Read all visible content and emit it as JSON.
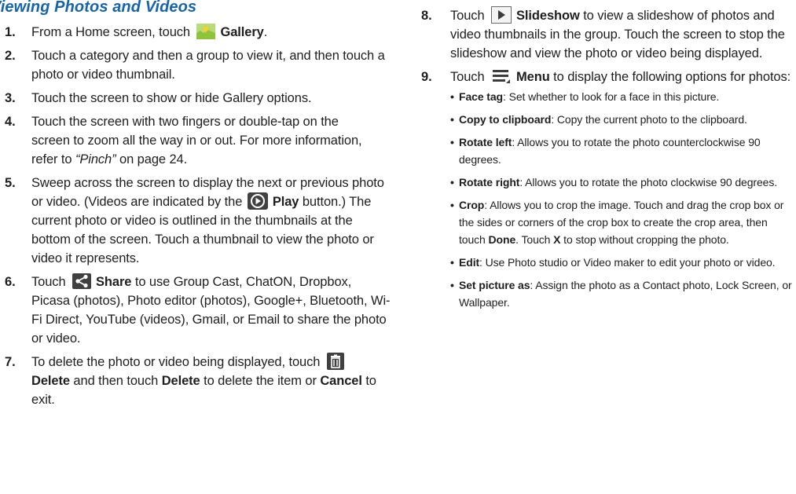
{
  "heading": "Viewing Photos and Videos",
  "left_steps": [
    {
      "num": "1.",
      "a": "From a Home screen, touch",
      "icon": "gallery-icon",
      "bold": "Gallery",
      "b": "."
    },
    {
      "num": "2.",
      "text": "Touch a category and then a group to view it, and then touch a photo or video thumbnail."
    },
    {
      "num": "3.",
      "text": "Touch the screen to show or hide Gallery options."
    },
    {
      "num": "4.",
      "a": "Touch the screen with two fingers or double-tap on the screen to zoom all the way in or out. For more information, refer to ",
      "ref": "“Pinch”",
      "b": " on page 24."
    },
    {
      "num": "5.",
      "a": "Sweep across the screen to display the next or previous photo or video. (Videos are indicated by the",
      "icon": "play-icon",
      "bold": "Play",
      "b": " button.) The current photo or video is outlined in the thumbnails at the bottom of the screen. Touch a thumbnail to view the photo or video it represents."
    },
    {
      "num": "6.",
      "a": "Touch",
      "icon": "share-icon",
      "bold": "Share",
      "b": " to use Group Cast, ChatON, Dropbox, Picasa (photos), Photo editor (photos), Google+, Bluetooth, Wi-Fi Direct, YouTube (videos), Gmail, or Email to share the photo or video."
    },
    {
      "num": "7.",
      "a": "To delete the photo or video being displayed, touch",
      "icon": "trash-icon",
      "bold": "Delete",
      "b": " and then touch ",
      "bold2": "Delete",
      "c": " to delete the item or ",
      "bold3": "Cancel",
      "d": " to exit."
    }
  ],
  "right_steps": [
    {
      "num": "8.",
      "a": "Touch",
      "icon": "slideshow-icon",
      "bold": "Slideshow",
      "b": " to view a slideshow of photos and video thumbnails in the group. Touch the screen to stop the slideshow and view the photo or video being displayed."
    },
    {
      "num": "9.",
      "a": "Touch",
      "icon": "menu-icon",
      "bold": "Menu",
      "b": " to display the following options for photos:"
    }
  ],
  "options": [
    {
      "bold": "Face tag",
      "text": ": Set whether to look for a face in this picture."
    },
    {
      "bold": "Copy to clipboard",
      "text": ": Copy the current photo to the clipboard."
    },
    {
      "bold": "Rotate left",
      "text": ": Allows you to rotate the photo counterclockwise 90 degrees."
    },
    {
      "bold": "Rotate right",
      "text": ": Allows you to rotate the photo clockwise 90 degrees."
    },
    {
      "bold": "Crop",
      "text": ": Allows you to crop the image. Touch and drag the crop box or the sides or corners of the crop box to create the crop area, then touch ",
      "bold2": "Done",
      "text2": ". Touch ",
      "bold3": "X",
      "text3": " to stop without cropping the photo."
    },
    {
      "bold": "Edit",
      "text": ": Use Photo studio or Video maker to edit your photo or video."
    },
    {
      "bold": "Set picture as",
      "text": ": Assign the photo as a Contact photo, Lock Screen, or Wallpaper."
    }
  ],
  "colors": {
    "heading": "#1565ad",
    "text": "#1e1e1e",
    "icon_dark": "#3c3c3c"
  }
}
